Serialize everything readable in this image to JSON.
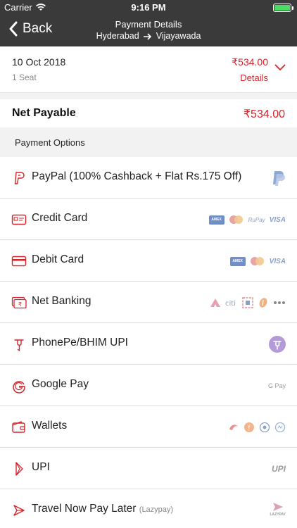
{
  "status_bar": {
    "carrier": "Carrier",
    "time": "9:16 PM"
  },
  "nav": {
    "back_label": "Back",
    "title": "Payment Details",
    "from": "Hyderabad",
    "to": "Vijayawada"
  },
  "trip": {
    "date": "10 Oct 2018",
    "seats": "1 Seat",
    "price": "₹534.00",
    "details_label": "Details"
  },
  "net_payable": {
    "label": "Net Payable",
    "amount": "₹534.00"
  },
  "payment_options_header": "Payment Options",
  "options": [
    {
      "name": "PayPal (100% Cashback + Flat Rs.175 Off)",
      "icon": "paypal-icon"
    },
    {
      "name": "Credit Card",
      "icon": "credit-card-icon",
      "logos": {
        "rupay": "RuPay",
        "visa": "VISA"
      }
    },
    {
      "name": "Debit Card",
      "icon": "debit-card-icon",
      "logos": {
        "visa": "VISA"
      }
    },
    {
      "name": "Net Banking",
      "icon": "net-banking-icon"
    },
    {
      "name": "PhonePe/BHIM UPI",
      "icon": "phonepe-icon"
    },
    {
      "name": "Google Pay",
      "icon": "google-pay-icon",
      "logos": {
        "gpay": "G Pay"
      }
    },
    {
      "name": "Wallets",
      "icon": "wallet-icon"
    },
    {
      "name": "UPI",
      "icon": "upi-icon",
      "logos": {
        "upi": "UPI"
      }
    },
    {
      "name": "Travel Now Pay Later",
      "sub": "(Lazypay)",
      "icon": "lazypay-icon",
      "logos": {
        "lazypay": "LAZYPAY"
      }
    }
  ],
  "colors": {
    "accent": "#d7232a",
    "header": "#3a3a3a",
    "section_bg": "#f2f2f2"
  }
}
